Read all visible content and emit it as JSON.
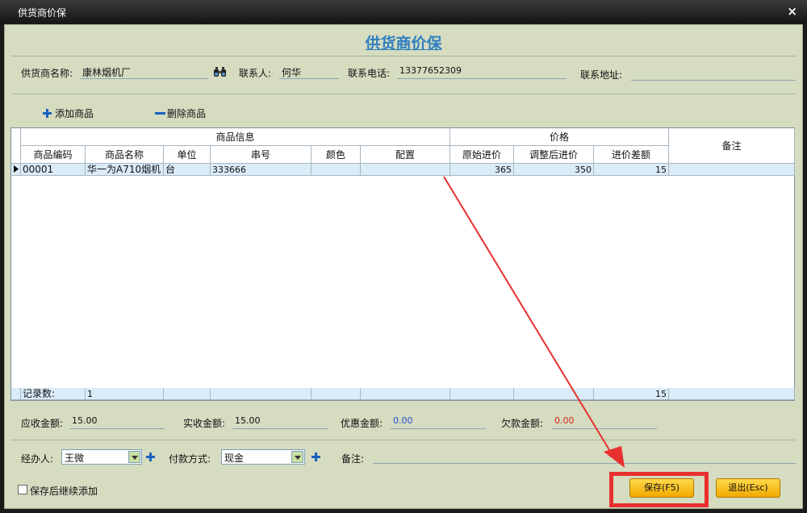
{
  "window": {
    "title": "供货商价保",
    "close": "×"
  },
  "heading": "供货商价保",
  "supplier": {
    "name_label": "供货商名称:",
    "name_value": "康林烟机厂",
    "contact_label": "联系人:",
    "contact_value": "何华",
    "phone_label": "联系电话:",
    "phone_value": "13377652309",
    "address_label": "联系地址:",
    "address_value": ""
  },
  "toolbar": {
    "add_label": "添加商品",
    "delete_label": "删除商品"
  },
  "grid": {
    "group_headers": {
      "info": "商品信息",
      "price": "价格",
      "remark": "备注"
    },
    "columns": [
      "商品编码",
      "商品名称",
      "单位",
      "串号",
      "颜色",
      "配置",
      "原始进价",
      "调整后进价",
      "进价差额"
    ],
    "rows": [
      {
        "code": "00001",
        "name": "华一为A710烟机",
        "unit": "台",
        "serial": "333666",
        "color": "",
        "config": "",
        "orig_price": "365",
        "adj_price": "350",
        "diff": "15",
        "remark": ""
      }
    ],
    "footer": {
      "label": "记录数:",
      "count": "1",
      "diff_total": "15"
    }
  },
  "amounts": {
    "receivable_label": "应收金额:",
    "receivable_value": "15.00",
    "received_label": "实收金额:",
    "received_value": "15.00",
    "discount_label": "优惠金额:",
    "discount_value": "0.00",
    "owed_label": "欠款金额:",
    "owed_value": "0.00"
  },
  "colors": {
    "discount": "#2a4fd0",
    "owed": "#d92020",
    "highlight": "#e8302f"
  },
  "form": {
    "handler_label": "经办人:",
    "handler_value": "王微",
    "payment_label": "付款方式:",
    "payment_value": "现金",
    "note_label": "备注:",
    "note_value": ""
  },
  "footer": {
    "continue_label": "保存后继续添加",
    "save_label": "保存(F5)",
    "exit_label": "退出(Esc)"
  }
}
